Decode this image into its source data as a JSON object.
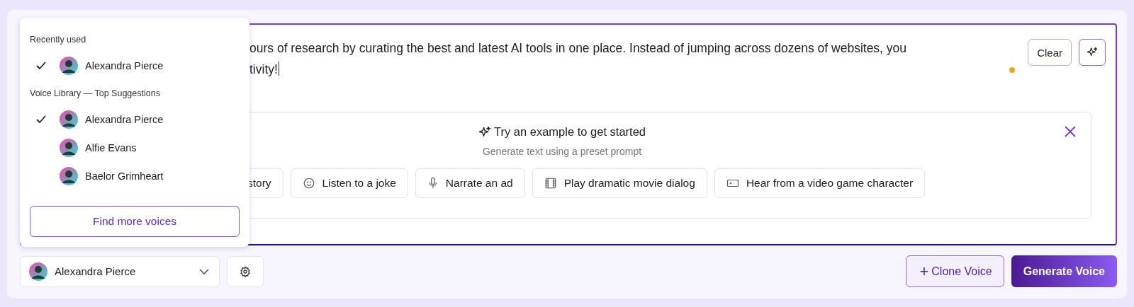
{
  "editor": {
    "lines": [
      "ours of research by curating the best and latest AI tools in one place. Instead of jumping across dozens of websites, you",
      "tivity!"
    ],
    "clear_button": "Clear"
  },
  "examples": {
    "title": "Try an example to get started",
    "subtitle": "Generate text using a preset prompt",
    "chips": [
      {
        "label": "story",
        "kind": "plain"
      },
      {
        "label": "Listen to a joke",
        "kind": "joke"
      },
      {
        "label": "Narrate an ad",
        "kind": "voice"
      },
      {
        "label": "Play dramatic movie dialog",
        "kind": "movie"
      },
      {
        "label": "Hear from a video game character",
        "kind": "game"
      }
    ]
  },
  "dropdown": {
    "sections": [
      {
        "heading": "Recently used",
        "voices": [
          {
            "name": "Alexandra Pierce",
            "selected": true
          }
        ]
      },
      {
        "heading": "Voice Library — Top Suggestions",
        "voices": [
          {
            "name": "Alexandra Pierce",
            "selected": true
          },
          {
            "name": "Alfie Evans",
            "selected": false
          },
          {
            "name": "Baelor Grimheart",
            "selected": false
          }
        ]
      }
    ],
    "find_button": "Find more voices"
  },
  "voice_select": {
    "value": "Alexandra Pierce"
  },
  "clone_button": "Clone Voice",
  "clone_icon": "+",
  "generate_button": "Generate Voice"
}
